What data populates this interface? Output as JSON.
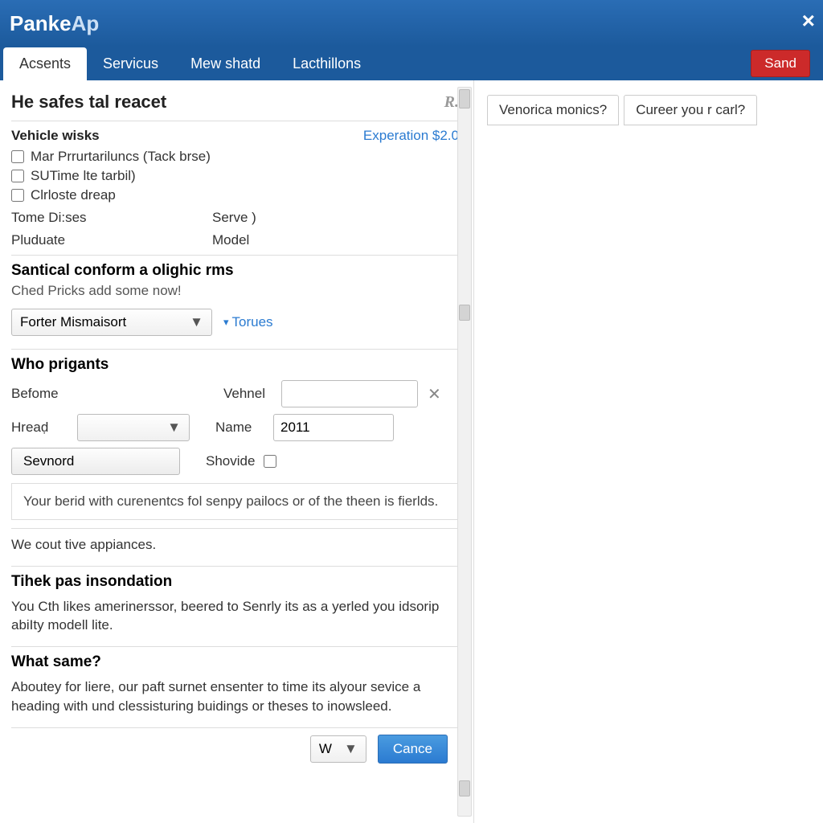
{
  "brand": {
    "p1": "Panke",
    "p2": "Ap"
  },
  "close": "×",
  "tabs": [
    "Acsents",
    "Servicus",
    "Mew shatd",
    "Lacthillons"
  ],
  "sand": "Sand",
  "section": {
    "title": "He safes tal reacet",
    "vehicle_wisks": "Vehicle wisks",
    "exp": "Experation $2.0",
    "checks": [
      "Mar Prrurtariluncs (Tack brse)",
      "SUTime lte tarbil)",
      "Clrloste dreap"
    ],
    "r1": {
      "a": "Tome Di:ses",
      "b": "Serve )"
    },
    "r2": {
      "a": "Pluduate",
      "b": "Model"
    }
  },
  "santical": {
    "head": "Santical conform a olighic rms",
    "sub": "Ched Pricks add some now!",
    "dd": "Forter Mismaisort",
    "torues": "Torues"
  },
  "who": {
    "head": "Who prigants",
    "befome": "Befome",
    "vehnel": "Vehnel",
    "hread": "Hreaḍ",
    "name": "Name",
    "name_val": "2011",
    "sevnord": "Sevnord",
    "shovide": "Shovide",
    "note": "Your berid with curenentcs fol senpy pailocs or of the theen is fierlds."
  },
  "appy": "We cout tive appiances.",
  "tihek": {
    "head": "Tihek pas insondation",
    "body": "You Cth likes amerinerssor, beered to Senrly its as a yerled you idsorip abiIty modell lite."
  },
  "what": {
    "head": "What same?",
    "body": "Aboutey for liere, our paft surnet ensenter to time its alyour sevice a heading with und clessisturing buidings or theses to inowsleed."
  },
  "bottom": {
    "w": "W",
    "cance": "Cance"
  },
  "right": {
    "t1": "Venorica monics?",
    "t2": "Cureer you r carl?"
  }
}
